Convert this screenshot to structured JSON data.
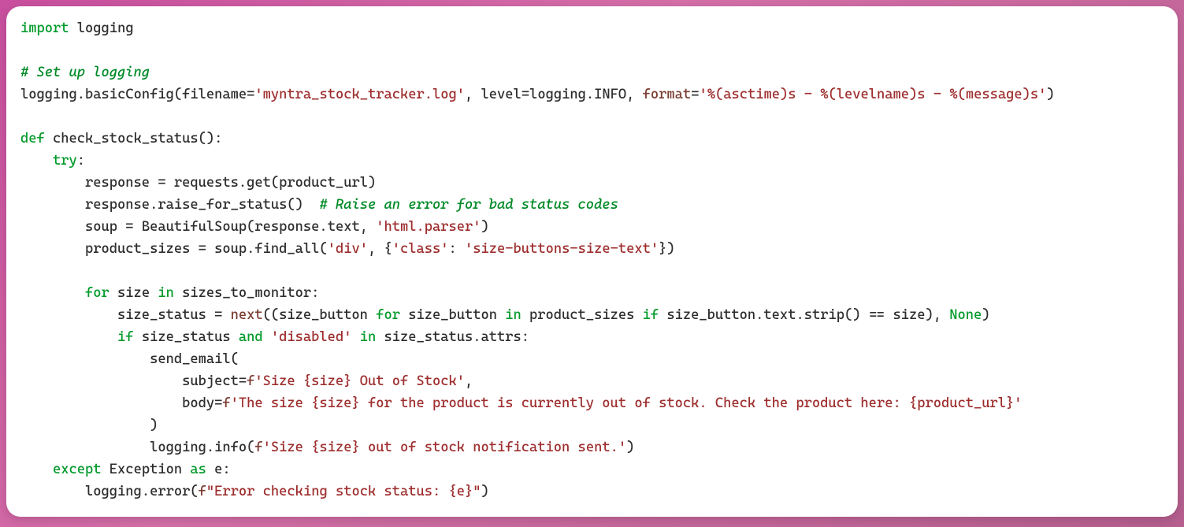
{
  "code": {
    "line1_import": "import",
    "line1_module": "logging",
    "line3_comment": "# Set up logging",
    "line4_logging": "logging",
    "line4_dot1": ".",
    "line4_basicConfig": "basicConfig",
    "line4_open": "(",
    "line4_filename_kw": "filename",
    "line4_eq1": "=",
    "line4_filename_val": "'myntra_stock_tracker.log'",
    "line4_comma1": ", ",
    "line4_level_kw": "level",
    "line4_eq2": "=",
    "line4_level_val_mod": "logging",
    "line4_level_dot": ".",
    "line4_level_attr": "INFO",
    "line4_comma2": ", ",
    "line4_format_kw": "format",
    "line4_eq3": "=",
    "line4_format_val": "'%(asctime)s - %(levelname)s - %(message)s'",
    "line4_close": ")",
    "line6_def": "def",
    "line6_name": "check_stock_status",
    "line6_parens": "():",
    "line7_try": "try",
    "line7_colon": ":",
    "line8_response": "response",
    "line8_eq": " = ",
    "line8_requests": "requests",
    "line8_dot": ".",
    "line8_get": "get",
    "line8_open": "(",
    "line8_arg": "product_url",
    "line8_close": ")",
    "line9_response": "response",
    "line9_dot": ".",
    "line9_rfs": "raise_for_status",
    "line9_call": "()",
    "line9_spaces": "  ",
    "line9_comment": "# Raise an error for bad status codes",
    "line10_soup": "soup",
    "line10_eq": " = ",
    "line10_bs": "BeautifulSoup",
    "line10_open": "(",
    "line10_resp": "response",
    "line10_dot": ".",
    "line10_text": "text",
    "line10_comma": ", ",
    "line10_parser": "'html.parser'",
    "line10_close": ")",
    "line11_ps": "product_sizes",
    "line11_eq": " = ",
    "line11_soup": "soup",
    "line11_dot": ".",
    "line11_findall": "find_all",
    "line11_open": "(",
    "line11_div": "'div'",
    "line11_comma": ", {",
    "line11_classkey": "'class'",
    "line11_colon": ": ",
    "line11_classval": "'size-buttons-size-text'",
    "line11_close": "})",
    "line13_for": "for",
    "line13_size": " size ",
    "line13_in": "in",
    "line13_coll": " sizes_to_monitor:",
    "line14_ss": "size_status",
    "line14_eq": " = ",
    "line14_next": "next",
    "line14_open": "((",
    "line14_sb1": "size_button ",
    "line14_for": "for",
    "line14_sb2": " size_button ",
    "line14_in": "in",
    "line14_ps": " product_sizes ",
    "line14_if": "if",
    "line14_cond_lhs": " size_button",
    "line14_cond_dot1": ".",
    "line14_cond_text": "text",
    "line14_cond_dot2": ".",
    "line14_cond_strip": "strip",
    "line14_cond_call": "() == size), ",
    "line14_none": "None",
    "line14_close": ")",
    "line15_if": "if",
    "line15_ss": " size_status ",
    "line15_and": "and",
    "line15_sp": " ",
    "line15_disabled": "'disabled'",
    "line15_sp2": " ",
    "line15_in": "in",
    "line15_attrs": " size_status.attrs:",
    "line16_sendemail": "send_email(",
    "line17_subject_kw": "subject",
    "line17_eq": "=",
    "line17_f": "f",
    "line17_val": "'Size {size} Out of Stock'",
    "line17_comma": ",",
    "line18_body_kw": "body",
    "line18_eq": "=",
    "line18_f": "f",
    "line18_val": "'The size {size} for the product is currently out of stock. Check the product here: {product_url}'",
    "line19_close": ")",
    "line20_logging": "logging",
    "line20_dot": ".",
    "line20_info": "info",
    "line20_open": "(",
    "line20_f": "f",
    "line20_val": "'Size {size} out of stock notification sent.'",
    "line20_close": ")",
    "line21_except": "except",
    "line21_exc": " Exception ",
    "line21_as": "as",
    "line21_e": " e:",
    "line22_logging": "logging",
    "line22_dot": ".",
    "line22_error": "error",
    "line22_open": "(",
    "line22_f": "f",
    "line22_val": "\"Error checking stock status: {e}\"",
    "line22_close": ")"
  }
}
